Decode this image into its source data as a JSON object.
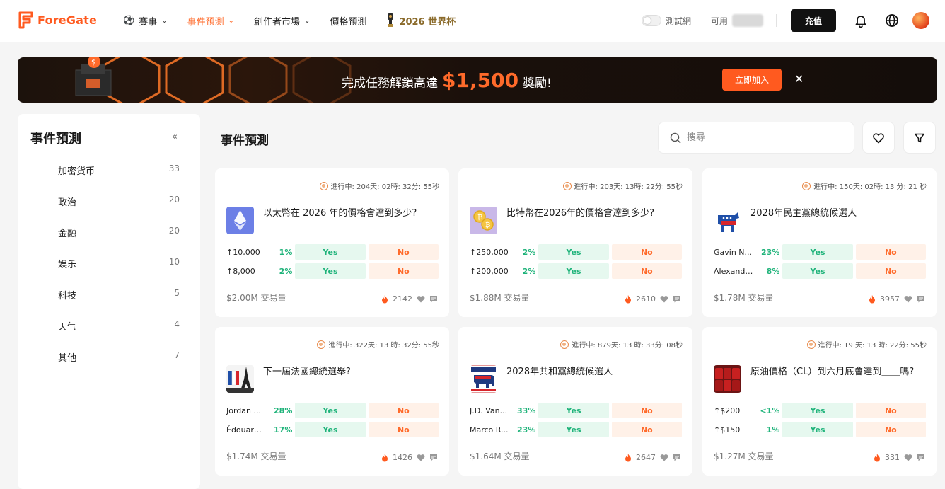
{
  "brand": {
    "name": "ForeGate",
    "color": "#ff5a1f"
  },
  "nav": [
    {
      "label": "賽事",
      "icon": "soccer-ball-icon",
      "dropdown": true,
      "active": false
    },
    {
      "label": "事件預測",
      "dropdown": true,
      "active": true
    },
    {
      "label": "創作者市場",
      "dropdown": true,
      "active": false
    },
    {
      "label": "價格預測",
      "dropdown": false,
      "active": false
    },
    {
      "label": "2026 世界杯",
      "icon": "trophy-icon",
      "dropdown": false,
      "active": false
    }
  ],
  "header": {
    "testnet_label": "測試網",
    "available_label": "可用",
    "charge_button": "充值"
  },
  "banner": {
    "text_before": "完成任務解鎖高達",
    "amount": "$1,500",
    "text_after": "獎勵!",
    "join_button": "立即加入"
  },
  "sidebar": {
    "title": "事件預測",
    "categories": [
      {
        "label": "加密货币",
        "count": "33"
      },
      {
        "label": "政治",
        "count": "20"
      },
      {
        "label": "金融",
        "count": "20"
      },
      {
        "label": "娱乐",
        "count": "10"
      },
      {
        "label": "科技",
        "count": "5"
      },
      {
        "label": "天气",
        "count": "4"
      },
      {
        "label": "其他",
        "count": "7"
      }
    ]
  },
  "main": {
    "title": "事件預測",
    "search_placeholder": "搜尋"
  },
  "cards": [
    {
      "status": "進行中: 204天: 02時: 32分: 55秒",
      "thumb": "ethereum-icon",
      "title": "以太幣在 2026 年的價格會達到多少?",
      "options": [
        {
          "name": "↑10,000",
          "pct": "1%",
          "yes": "Yes",
          "no": "No"
        },
        {
          "name": "↑8,000",
          "pct": "2%",
          "yes": "Yes",
          "no": "No"
        }
      ],
      "volume": "$2.00M 交易量",
      "likes": "2142"
    },
    {
      "status": "進行中: 203天: 13時: 22分: 55秒",
      "thumb": "bitcoin-coins-icon",
      "title": "比特幣在2026年的價格會達到多少?",
      "options": [
        {
          "name": "↑250,000",
          "pct": "2%",
          "yes": "Yes",
          "no": "No"
        },
        {
          "name": "↑200,000",
          "pct": "2%",
          "yes": "Yes",
          "no": "No"
        }
      ],
      "volume": "$1.88M 交易量",
      "likes": "2610"
    },
    {
      "status": "進行中: 150天: 02時: 13 分: 21 秒",
      "thumb": "democrat-donkey-icon",
      "title": "2028年民主黨總統候選人",
      "options": [
        {
          "name": "Gavin N...",
          "pct": "23%",
          "yes": "Yes",
          "no": "No"
        },
        {
          "name": "Alexandri...",
          "pct": "8%",
          "yes": "Yes",
          "no": "No"
        }
      ],
      "volume": "$1.78M 交易量",
      "likes": "3957"
    },
    {
      "status": "進行中: 322天: 13 時: 32分: 55秒",
      "thumb": "eiffel-tower-icon",
      "title": "下一屆法國總統選舉?",
      "options": [
        {
          "name": "Jordan ...",
          "pct": "28%",
          "yes": "Yes",
          "no": "No"
        },
        {
          "name": "Édouard ...",
          "pct": "17%",
          "yes": "Yes",
          "no": "No"
        }
      ],
      "volume": "$1.74M 交易量",
      "likes": "1426"
    },
    {
      "status": "進行中: 879天: 13 時: 33分: 08秒",
      "thumb": "republican-elephant-icon",
      "title": "2028年共和黨總統候選人",
      "options": [
        {
          "name": "J.D. Van...",
          "pct": "33%",
          "yes": "Yes",
          "no": "No"
        },
        {
          "name": "Marco R...",
          "pct": "23%",
          "yes": "Yes",
          "no": "No"
        }
      ],
      "volume": "$1.64M 交易量",
      "likes": "2647"
    },
    {
      "status": "進行中: 19 天: 13 時: 22分: 55秒",
      "thumb": "oil-barrels-icon",
      "title": "原油價格（CL）到六月底會達到＿＿嗎?",
      "options": [
        {
          "name": "↑$200",
          "pct": "<1%",
          "yes": "Yes",
          "no": "No"
        },
        {
          "name": "↑$150",
          "pct": "1%",
          "yes": "Yes",
          "no": "No"
        }
      ],
      "volume": "$1.27M 交易量",
      "likes": "331"
    }
  ]
}
